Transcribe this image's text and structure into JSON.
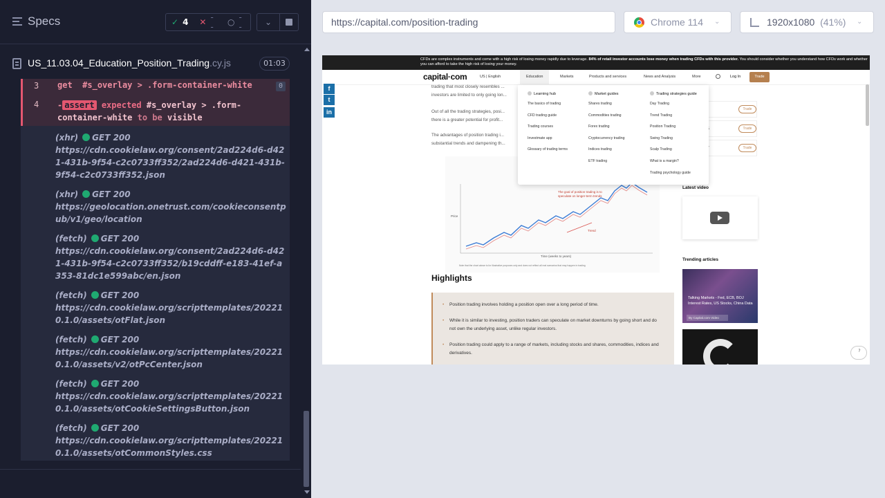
{
  "reporter": {
    "title": "Specs",
    "stats": {
      "passed": "4",
      "failed": "--",
      "pending": "--"
    },
    "spec": {
      "name": "US_11.03.04_Education_Position_Trading",
      "ext": ".cy.js",
      "duration": "01:03"
    },
    "commands": [
      {
        "line": "3",
        "type": "get",
        "selector": "#s_overlay > .form-container-white",
        "count": "0"
      },
      {
        "line": "4",
        "type": "assert",
        "prefix": "-",
        "tag": "assert",
        "expected": "expected",
        "selector": "#s_overlay > .form-container-white",
        "to_be": "to be",
        "state": "visible"
      }
    ],
    "requests": [
      {
        "kind": "(xhr)",
        "status": "GET 200",
        "url": "https://cdn.cookielaw.org/consent/2ad224d6-d421-431b-9f54-c2c0733ff352/2ad224d6-d421-431b-9f54-c2c0733ff352.json"
      },
      {
        "kind": "(xhr)",
        "status": "GET 200",
        "url": "https://geolocation.onetrust.com/cookieconsentpub/v1/geo/location"
      },
      {
        "kind": "(fetch)",
        "status": "GET 200",
        "url": "https://cdn.cookielaw.org/consent/2ad224d6-d421-431b-9f54-c2c0733ff352/b19cddff-e183-41ef-a353-81dc1e599abc/en.json"
      },
      {
        "kind": "(fetch)",
        "status": "GET 200",
        "url": "https://cdn.cookielaw.org/scripttemplates/202210.1.0/assets/otFlat.json"
      },
      {
        "kind": "(fetch)",
        "status": "GET 200",
        "url": "https://cdn.cookielaw.org/scripttemplates/202210.1.0/assets/v2/otPcCenter.json"
      },
      {
        "kind": "(fetch)",
        "status": "GET 200",
        "url": "https://cdn.cookielaw.org/scripttemplates/202210.1.0/assets/otCookieSettingsButton.json"
      },
      {
        "kind": "(fetch)",
        "status": "GET 200",
        "url": "https://cdn.cookielaw.org/scripttemplates/202210.1.0/assets/otCommonStyles.css"
      }
    ]
  },
  "aut": {
    "url": "https://capital.com/position-trading",
    "browser": "Chrome 114",
    "viewport": "1920x1080",
    "scale": "(41%)"
  },
  "site": {
    "risk_warning": "CFDs are complex instruments and come with a high risk of losing money rapidly due to leverage.",
    "risk_warning_bold": "84% of retail investor accounts lose money when trading CFDs with this provider.",
    "risk_warning_tail": "You should consider whether you understand how CFDs work and whether you can afford to take the high risk of losing your money.",
    "logo": "capital·com",
    "locale": "US | English",
    "nav": [
      "Education",
      "Markets",
      "Products and services",
      "News and Analysis",
      "More"
    ],
    "login": "Log In",
    "trade": "Trade",
    "body_text_1": "trading that most closely resembles ...",
    "body_text_2": "investors are limited to only going lon...",
    "body_text_3": "Out of all the trading strategies, posi...",
    "body_text_4": "there is a greater potential for profit...",
    "body_text_5": "The advantages of position trading i...",
    "body_text_6": "substantial trends and dampening th...",
    "chart_caption_1": "The goal of position trading is to",
    "chart_caption_2": "speculate on longer-term trends",
    "chart_trend_label": "Trend",
    "chart_y_label": "Price",
    "chart_x_label": "Time (weeks to years)",
    "chart_note": "Note that the chart above is for illustrative purposes only and does not reflect all real scenarios that may happen in trading",
    "highlights_title": "Highlights",
    "highlights": [
      "Position trading involves holding a position open over a long period of time.",
      "While it is similar to investing, position traders can speculate on market downturns by going short and do not own the underlying asset, unlike regular investors.",
      "Position trading could apply to a range of markets, including stocks and shares, commodities, indices and derivatives."
    ],
    "prices": [
      "35",
      "755",
      "757"
    ],
    "trade_label": "Trade",
    "latest_video": "Latest video",
    "trending": "Trending articles",
    "trend_caption": "Talking Markets - Fed, ECB, BOJ Interest Rates, US Stocks, China Data",
    "trend_by": "By Capital.com Video",
    "mega_menu": {
      "col1": {
        "head": "Learning hub",
        "items": [
          "The basics of trading",
          "CFD trading guide",
          "Trading courses",
          "Investmate app",
          "Glossary of trading terms"
        ]
      },
      "col2": {
        "head": "Market guides",
        "items": [
          "Shares trading",
          "Commodities trading",
          "Forex trading",
          "Cryptocurrency trading",
          "Indices trading",
          "ETF trading"
        ]
      },
      "col3": {
        "head": "Trading strategies guide",
        "items": [
          "Day Trading",
          "Trend Trading",
          "Position Trading",
          "Swing Trading",
          "Scalp Trading",
          "What is a margin?",
          "Trading psychology guide"
        ]
      }
    }
  },
  "colors": {
    "reporter_bg": "#1b1e2e",
    "pass": "#1fa971",
    "fail": "#e45770",
    "aut_bg": "#e1e4ec",
    "brand_accent": "#b5804f"
  }
}
